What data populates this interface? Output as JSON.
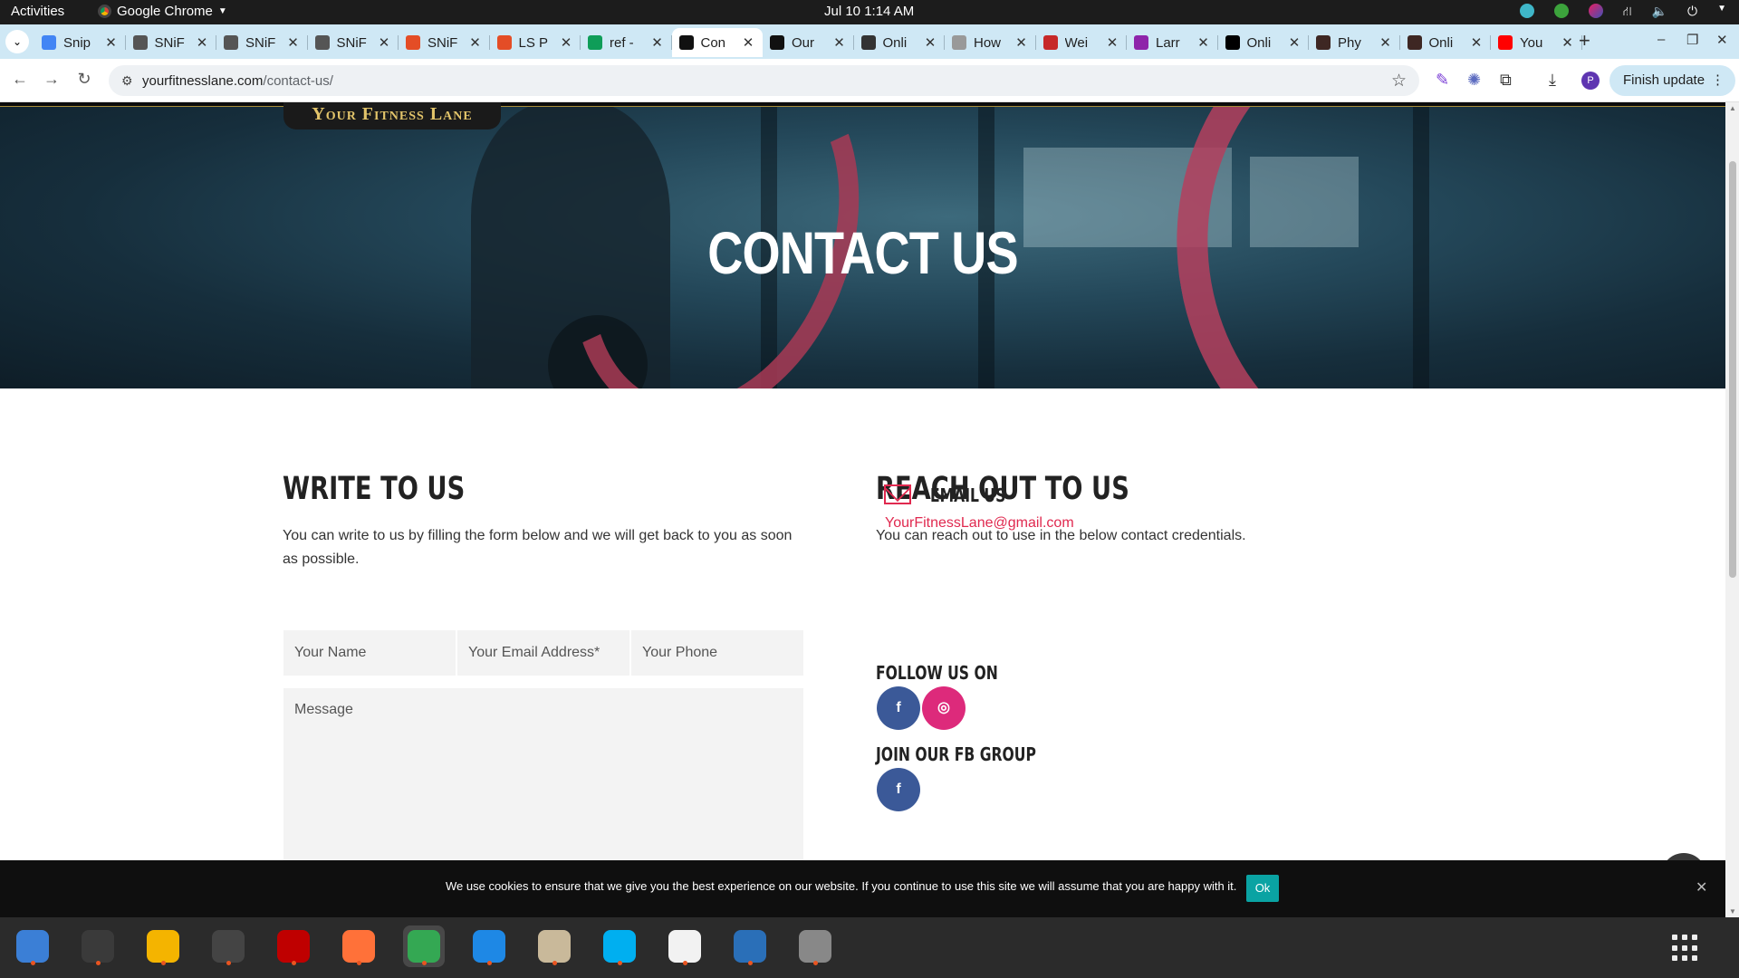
{
  "topbar": {
    "activities": "Activities",
    "app_name": "Google Chrome",
    "clock": "Jul 10  1:14 AM"
  },
  "tabs": [
    {
      "title": "Snip",
      "color": "#4285f4"
    },
    {
      "title": "SNiF",
      "color": "#555555"
    },
    {
      "title": "SNiF",
      "color": "#555555"
    },
    {
      "title": "SNiF",
      "color": "#555555"
    },
    {
      "title": "SNiF",
      "color": "#e44d26"
    },
    {
      "title": "LS P",
      "color": "#e44d26"
    },
    {
      "title": "ref -",
      "color": "#0f9d58"
    },
    {
      "title": "Con",
      "color": "#111111",
      "active": true
    },
    {
      "title": "Our",
      "color": "#111111"
    },
    {
      "title": "Onli",
      "color": "#333333"
    },
    {
      "title": "How",
      "color": "#999999"
    },
    {
      "title": "Wei",
      "color": "#c62828"
    },
    {
      "title": "Larr",
      "color": "#8e24aa"
    },
    {
      "title": "Onli",
      "color": "#000000"
    },
    {
      "title": "Phy",
      "color": "#3e2723"
    },
    {
      "title": "Onli",
      "color": "#3e2723"
    },
    {
      "title": "You",
      "color": "#ff0000"
    }
  ],
  "toolbar": {
    "url_host": "yourfitnesslane.com",
    "url_path": "/contact-us/",
    "finish_update": "Finish update",
    "profile_initial": "P"
  },
  "page": {
    "logo": "Your Fitness Lane",
    "hero_title": "CONTACT US",
    "write": {
      "title": "WRITE TO US",
      "text": "You can write to us by filling the form below and we will get back to you as soon as possible.",
      "name_placeholder": "Your Name",
      "email_placeholder": "Your Email Address*",
      "phone_placeholder": "Your Phone",
      "message_placeholder": "Message"
    },
    "reach": {
      "title": "REACH OUT TO US",
      "text": "You can reach out to use in the below contact credentials.",
      "email_title": "EMAIL US",
      "email": "YourFitnessLane@gmail.com",
      "follow_title": "FOLLOW US ON",
      "fb_group_title": "JOIN OUR FB GROUP"
    },
    "cookie": {
      "text": "We use cookies to ensure that we give you the best experience on our website. If you continue to use this site we will assume that you are happy with it.",
      "ok": "Ok"
    }
  },
  "colors": {
    "accent_red": "#e0294f",
    "facebook": "#3b5998",
    "instagram": "#dd2a7b",
    "cookie_ok": "#0aa3a3",
    "tab_strip": "#cfe8f5"
  },
  "dock": [
    {
      "name": "thunderbird-icon",
      "color": "#3b7fd6"
    },
    {
      "name": "terminal-icon",
      "color": "#3a3a3a"
    },
    {
      "name": "calculator-icon",
      "color": "#f4b400"
    },
    {
      "name": "system-monitor-icon",
      "color": "#444444"
    },
    {
      "name": "filezilla-icon",
      "color": "#bf0000"
    },
    {
      "name": "firefox-icon",
      "color": "#ff7139"
    },
    {
      "name": "chrome-icon",
      "color": "#34a853",
      "active": true
    },
    {
      "name": "vscode-icon",
      "color": "#1e88e5"
    },
    {
      "name": "files-icon",
      "color": "#c9b99a"
    },
    {
      "name": "skype-icon",
      "color": "#00aff0"
    },
    {
      "name": "text-editor-icon",
      "color": "#f2f2f2"
    },
    {
      "name": "libreoffice-writer-icon",
      "color": "#2a6fb8"
    },
    {
      "name": "disks-icon",
      "color": "#888888"
    }
  ]
}
